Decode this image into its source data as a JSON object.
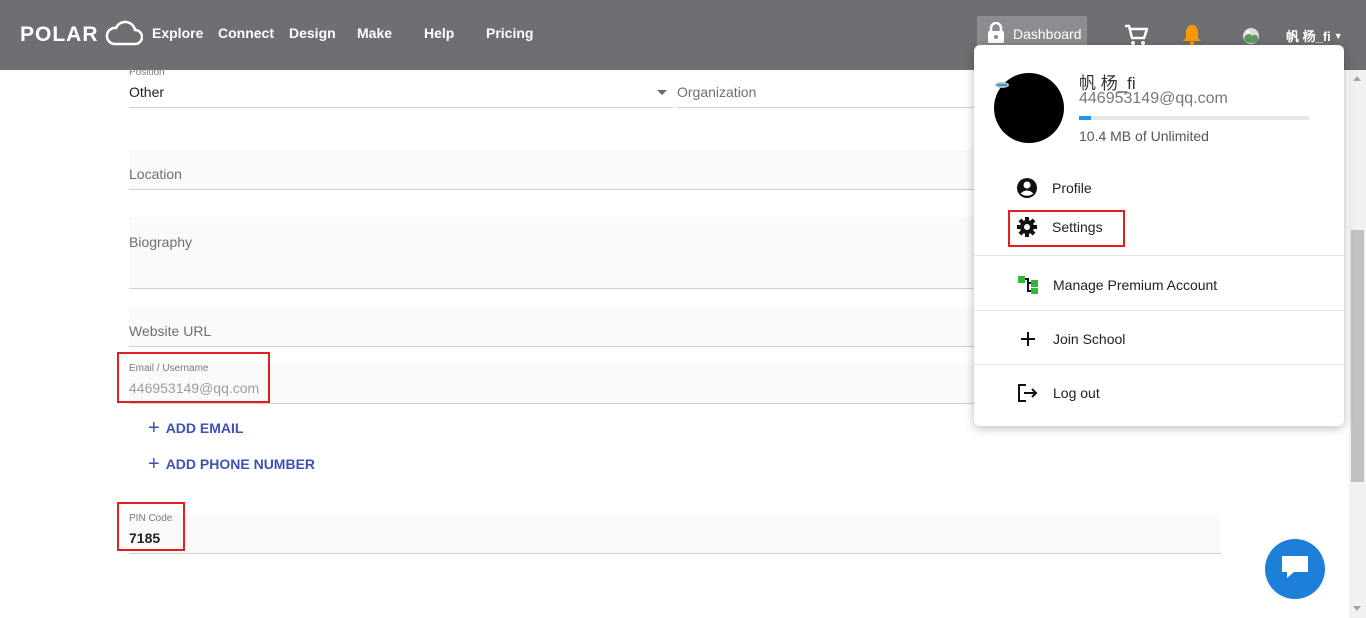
{
  "header": {
    "logo_text": "POLAR",
    "nav": [
      "Explore",
      "Connect",
      "Design",
      "Make",
      "Help",
      "Pricing"
    ],
    "dashboard_label": "Dashboard",
    "user_name": "帆 杨_fi"
  },
  "form": {
    "position_label": "Position",
    "position_value": "Other",
    "organization_placeholder": "Organization",
    "location_placeholder": "Location",
    "biography_placeholder": "Biography",
    "website_placeholder": "Website URL",
    "email_label": "Email / Username",
    "email_value": "446953149@qq.com",
    "add_email": "ADD EMAIL",
    "add_phone": "ADD PHONE NUMBER",
    "pin_label": "PIN Code",
    "pin_value": "7185"
  },
  "menu": {
    "name": "帆 杨_fi",
    "email": "446953149@qq.com",
    "storage_text": "10.4 MB of Unlimited",
    "storage_fraction": 0.05,
    "items": [
      "Profile",
      "Settings",
      "Manage Premium Account",
      "Join School",
      "Log out"
    ]
  },
  "colors": {
    "topbar": "#6e6f72",
    "accent_link": "#3f51b5",
    "highlight_box": "#e02020",
    "chat_button": "#1e7fd8",
    "bell": "#ff9800",
    "premium_icon": "#2fb83a"
  },
  "icons": [
    "cloud-icon",
    "lock-icon",
    "cart-icon",
    "bell-icon",
    "account-circle-icon",
    "gear-icon",
    "premium-tree-icon",
    "plus-icon",
    "logout-icon",
    "chat-icon"
  ]
}
